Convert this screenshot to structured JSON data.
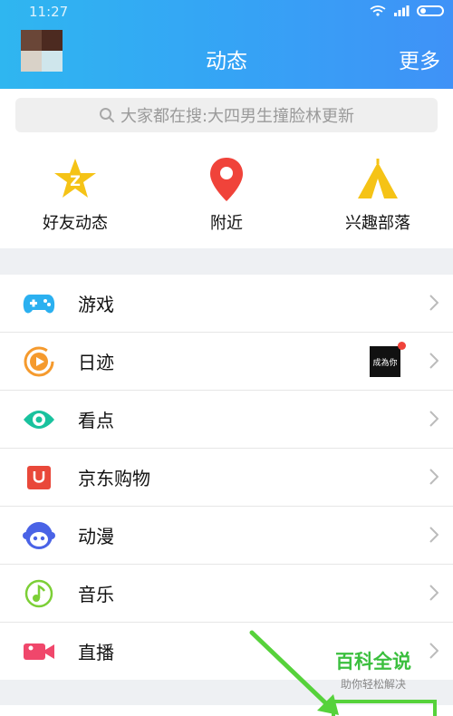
{
  "status_bar": {
    "time": "11:27"
  },
  "header": {
    "title": "动态",
    "more_label": "更多"
  },
  "search": {
    "placeholder": "大家都在搜:大四男生撞脸林更新"
  },
  "quick_actions": [
    {
      "label": "好友动态",
      "icon": "star-badge-icon",
      "color": "#f5c316"
    },
    {
      "label": "附近",
      "icon": "location-pin-icon",
      "color": "#f0433a"
    },
    {
      "label": "兴趣部落",
      "icon": "tent-icon",
      "color": "#f5c316"
    }
  ],
  "menu_items": [
    {
      "label": "游戏",
      "icon": "gamepad-icon",
      "color": "#2bb0f0"
    },
    {
      "label": "日迹",
      "icon": "play-circle-icon",
      "color": "#f59a2d",
      "thumbnail_text": "成為你",
      "has_badge": true
    },
    {
      "label": "看点",
      "icon": "eye-icon",
      "color": "#19c29e"
    },
    {
      "label": "京东购物",
      "icon": "shopping-bag-icon",
      "color": "#e9483a"
    },
    {
      "label": "动漫",
      "icon": "anime-face-icon",
      "color": "#4a63e6"
    },
    {
      "label": "音乐",
      "icon": "music-note-icon",
      "color": "#7ccf36"
    },
    {
      "label": "直播",
      "icon": "video-camera-icon",
      "color": "#f0476b"
    }
  ],
  "watermark": {
    "title": "百科全说",
    "subtitle": "助你轻松解决"
  }
}
